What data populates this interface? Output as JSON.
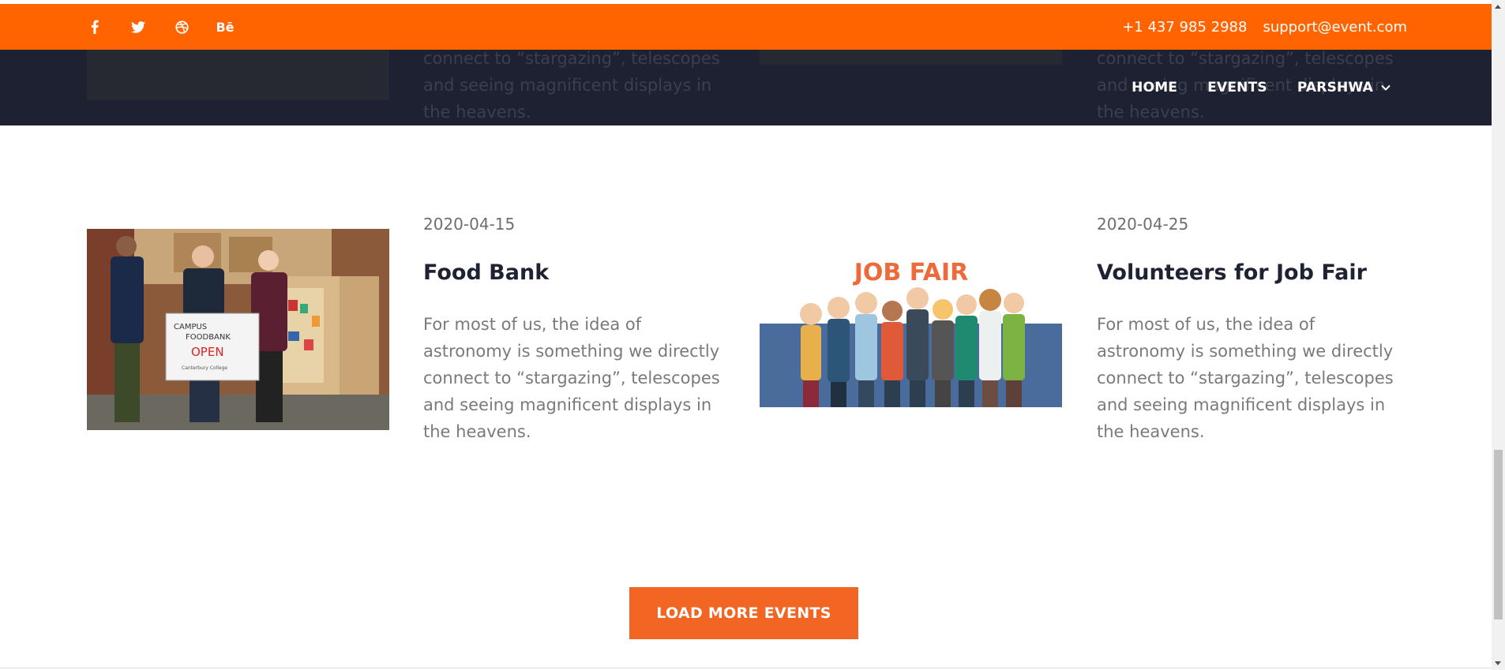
{
  "topbar": {
    "social": [
      "facebook-icon",
      "twitter-icon",
      "dribbble-icon",
      "behance-icon"
    ],
    "behance_label": "Bē",
    "phone": "+1 437 985 2988",
    "email": "support@event.com"
  },
  "nav": {
    "items": [
      {
        "label": "HOME"
      },
      {
        "label": "EVENTS"
      },
      {
        "label": "PARSHWA"
      }
    ]
  },
  "ghost_row": {
    "desc_left": "connect to “stargazing”, telescopes and seeing magnificent displays in the heavens.",
    "desc_right": "connect to “stargazing”, telescopes and seeing magnificent displays in the heavens."
  },
  "events": [
    {
      "date": "2020-04-15",
      "title": "Food Bank",
      "description": "For most of us, the idea of astronomy is something we directly connect to “stargazing”, telescopes and seeing magnificent displays in the heavens.",
      "image": {
        "sign_line1": "CAMPUS",
        "sign_line2": "FOODBANK",
        "sign_line3": "OPEN",
        "sign_line4": "Canterbury College"
      }
    },
    {
      "date": "2020-04-25",
      "title": "Volunteers for Job Fair",
      "description": "For most of us, the idea of astronomy is something we directly connect to “stargazing”, telescopes and seeing magnificent displays in the heavens.",
      "image": {
        "banner": "JOB FAIR"
      }
    }
  ],
  "load_more": {
    "label": "LOAD MORE EVENTS"
  },
  "colors": {
    "accent": "#ff6400",
    "nav_bg": "#1e2132",
    "button": "#f26522"
  }
}
